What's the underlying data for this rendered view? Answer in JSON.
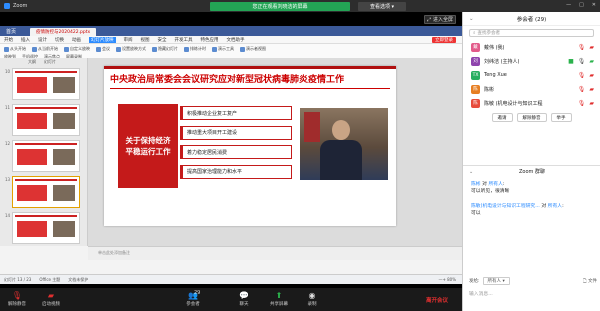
{
  "app": {
    "title": "Zoom",
    "window_buttons": [
      "—",
      "□",
      "✕"
    ]
  },
  "share": {
    "banner": "您正在观看刘晓洁的屏幕",
    "options": "查看选项 ▾",
    "fullscreen": "进入全屏"
  },
  "wps": {
    "tabs": {
      "home": "首页",
      "file": "疫情防控与2020422.pptx"
    },
    "menu": [
      "开始",
      "插入",
      "设计",
      "切换",
      "动画",
      "幻灯片放映",
      "审阅",
      "视图",
      "安全",
      "开发工具",
      "特色应用",
      "文档助手"
    ],
    "menu_active": "幻灯片放映",
    "sync": "立即登录",
    "ribbon_row1": [
      "从头开始",
      "从当前开始",
      "自定义放映",
      "会议",
      "设置放映方式",
      "隐藏幻灯片",
      "排练计时",
      "演示工具",
      "演示者视图",
      "屏幕录制"
    ],
    "ribbon_row2": [
      "放映到",
      "手机遥控",
      "演示焦点",
      "屏幕录制"
    ]
  },
  "thumbs": {
    "header_left": "大纲",
    "header_right": "幻灯片",
    "numbers": [
      "10",
      "11",
      "12",
      "13",
      "14"
    ]
  },
  "slide": {
    "title": "中央政治局常委会会议研究应对新型冠状病毒肺炎疫情工作",
    "redbox": "关于保持经济平稳运行工作",
    "items": [
      "积极推动企业复工复产",
      "推动重大项目开工建设",
      "着力稳定居民消费",
      "提高国家治理能力和水平"
    ]
  },
  "notes": "单击此处添加备注",
  "status": {
    "left": "幻灯片 13 / 23",
    "theme": "Office 主题",
    "spell": "文档未保护",
    "zoom": "—+ 80%"
  },
  "toolbar": {
    "mute": "解除静音",
    "video": "启动视频",
    "participants": "参会者",
    "participants_count": "29",
    "chat": "聊天",
    "share": "共享屏幕",
    "record": "录制",
    "end": "离开会议"
  },
  "panel": {
    "title": "参会者 (29)",
    "search_placeholder": "查找参会者",
    "participants": [
      {
        "avatar": "戴",
        "name": "戴伟 (我)",
        "color": "#e25b8a",
        "mic": "off",
        "cam": "off"
      },
      {
        "avatar": "刘",
        "name": "刘纬洁 (主持人)",
        "color": "#8e44ad",
        "mic": "on",
        "cam": "on"
      },
      {
        "avatar": "TX",
        "name": "Teng Xue",
        "color": "#27ae60",
        "mic": "off",
        "cam": "off"
      },
      {
        "avatar": "陈",
        "name": "陈彬",
        "color": "#e67e22",
        "mic": "off",
        "cam": "off"
      },
      {
        "avatar": "陈",
        "name": "陈敏 (机电设计与知识工程",
        "color": "#e74c3c",
        "mic": "off",
        "cam": "off"
      }
    ],
    "buttons": [
      "邀请",
      "解除静音",
      "举手"
    ],
    "chat_title": "Zoom 群聊",
    "messages": [
      {
        "from": "陈彬",
        "to": "所有人",
        "text": "可以听见，很清晰"
      },
      {
        "from": "陈敏",
        "to": "所有人",
        "from_full": "陈敏(机电设计与知识工程研究...",
        "text": "可以"
      }
    ],
    "send_to_label": "发给:",
    "send_to": "所有人 ▾",
    "file": "文件",
    "input_placeholder": "输入消息..."
  }
}
